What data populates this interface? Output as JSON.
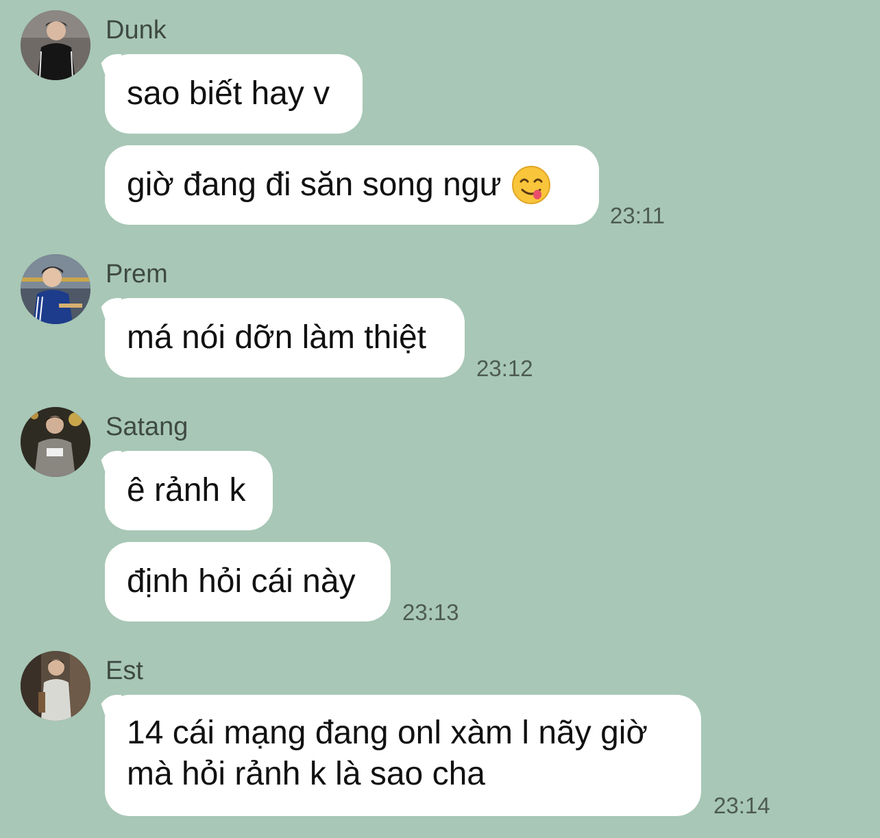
{
  "messages": [
    {
      "sender": "Dunk",
      "avatar_icon": "avatar-dunk-photo",
      "bubbles": [
        "sao biết hay v",
        "giờ đang đi săn song ngư"
      ],
      "emoji": "yum-face-emoji",
      "time": "23:11"
    },
    {
      "sender": "Prem",
      "avatar_icon": "avatar-prem-photo",
      "bubbles": [
        "má nói dỡn làm thiệt"
      ],
      "time": "23:12"
    },
    {
      "sender": "Satang",
      "avatar_icon": "avatar-satang-photo",
      "bubbles": [
        "ê rảnh k",
        "định hỏi cái này"
      ],
      "time": "23:13"
    },
    {
      "sender": "Est",
      "avatar_icon": "avatar-est-photo",
      "bubbles": [
        "14 cái mạng đang onl xàm l nãy giờ mà hỏi rảnh k là sao cha"
      ],
      "time": "23:14"
    }
  ],
  "colors": {
    "background": "#a8c7b6",
    "bubble": "#ffffff",
    "timestamp": "#4d5b53"
  }
}
